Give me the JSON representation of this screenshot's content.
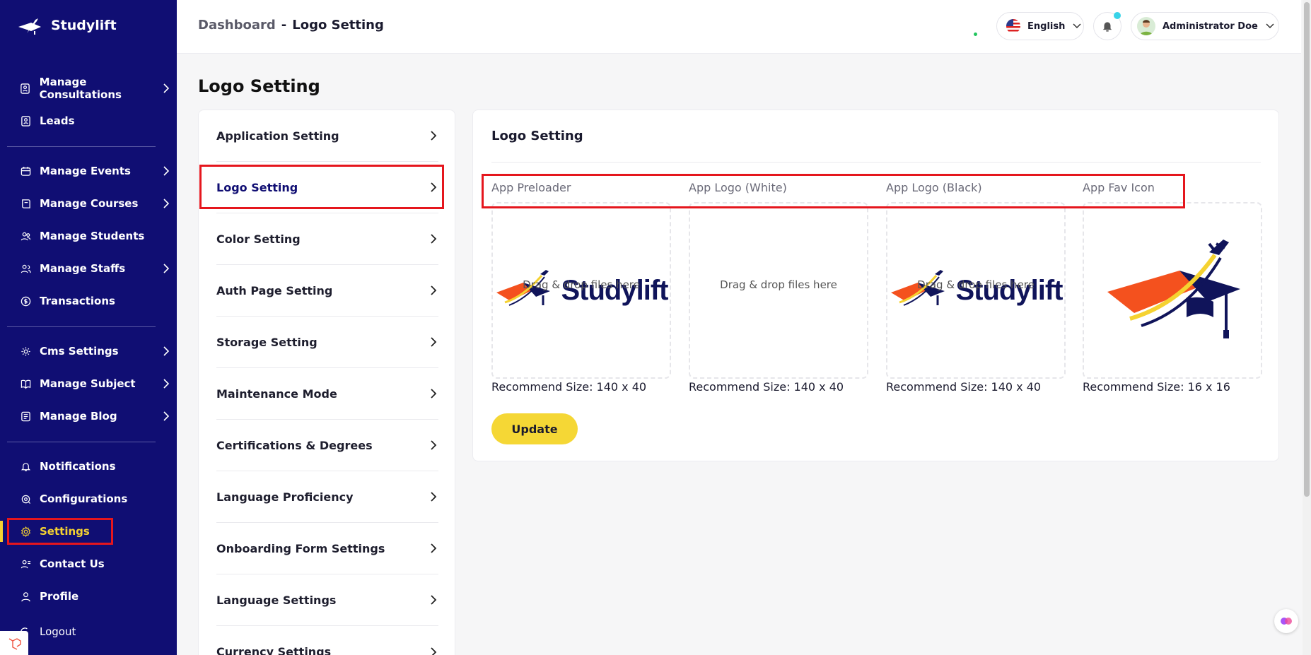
{
  "brand": {
    "name": "Studylift"
  },
  "sidebar": {
    "items": [
      {
        "label": "Manage Consultations",
        "icon": "user-badge-icon",
        "has_submenu": true
      },
      {
        "label": "Leads",
        "icon": "user-badge-icon",
        "has_submenu": false
      },
      {
        "label": "Manage Events",
        "icon": "calendar-icon",
        "has_submenu": true
      },
      {
        "label": "Manage Courses",
        "icon": "book-icon",
        "has_submenu": true
      },
      {
        "label": "Manage Students",
        "icon": "students-icon",
        "has_submenu": false
      },
      {
        "label": "Manage Staffs",
        "icon": "users-icon",
        "has_submenu": true
      },
      {
        "label": "Transactions",
        "icon": "money-icon",
        "has_submenu": false
      },
      {
        "label": "Cms Settings",
        "icon": "cms-icon",
        "has_submenu": true
      },
      {
        "label": "Manage Subject",
        "icon": "open-book-icon",
        "has_submenu": true
      },
      {
        "label": "Manage Blog",
        "icon": "blog-icon",
        "has_submenu": true
      },
      {
        "label": "Notifications",
        "icon": "bell-icon",
        "has_submenu": false
      },
      {
        "label": "Configurations",
        "icon": "config-icon",
        "has_submenu": false
      },
      {
        "label": "Settings",
        "icon": "gear-icon",
        "has_submenu": false,
        "active": true
      },
      {
        "label": "Contact Us",
        "icon": "contact-icon",
        "has_submenu": false
      },
      {
        "label": "Profile",
        "icon": "user-icon",
        "has_submenu": false
      },
      {
        "label": "Logout",
        "icon": "logout-icon",
        "has_submenu": false
      }
    ]
  },
  "header": {
    "breadcrumb": {
      "root": "Dashboard",
      "separator": "-",
      "current": "Logo Setting"
    },
    "language": "English",
    "user_name": "Administrator Doe"
  },
  "page": {
    "title": "Logo Setting"
  },
  "settings_menu": {
    "items": [
      "Application Setting",
      "Logo Setting",
      "Color Setting",
      "Auth Page Setting",
      "Storage Setting",
      "Maintenance Mode",
      "Certifications & Degrees",
      "Language Proficiency",
      "Onboarding Form Settings",
      "Language Settings",
      "Currency Settings"
    ],
    "selected": "Logo Setting"
  },
  "logo_setting": {
    "title": "Logo Setting",
    "uploads": [
      {
        "label": "App Preloader",
        "drop_text": "Drag & drop files here",
        "recommend": "Recommend Size: 140 x 40",
        "preview": "studylift-logo-dark"
      },
      {
        "label": "App Logo (White)",
        "drop_text": "Drag & drop files here",
        "recommend": "Recommend Size: 140 x 40",
        "preview": "studylift-logo-white"
      },
      {
        "label": "App Logo (Black)",
        "drop_text": "Drag & drop files here",
        "recommend": "Recommend Size: 140 x 40",
        "preview": "studylift-logo-dark"
      },
      {
        "label": "App Fav Icon",
        "drop_text": "",
        "recommend": "Recommend Size: 16 x 16",
        "preview": "studylift-favicon"
      }
    ],
    "logo_word": "Studylift",
    "update_label": "Update"
  },
  "colors": {
    "sidebar_bg": "#100e73",
    "accent_yellow": "#f5d735",
    "highlight_red": "#e5161d",
    "logo_orange": "#f4511e",
    "logo_navy": "#10145a"
  }
}
